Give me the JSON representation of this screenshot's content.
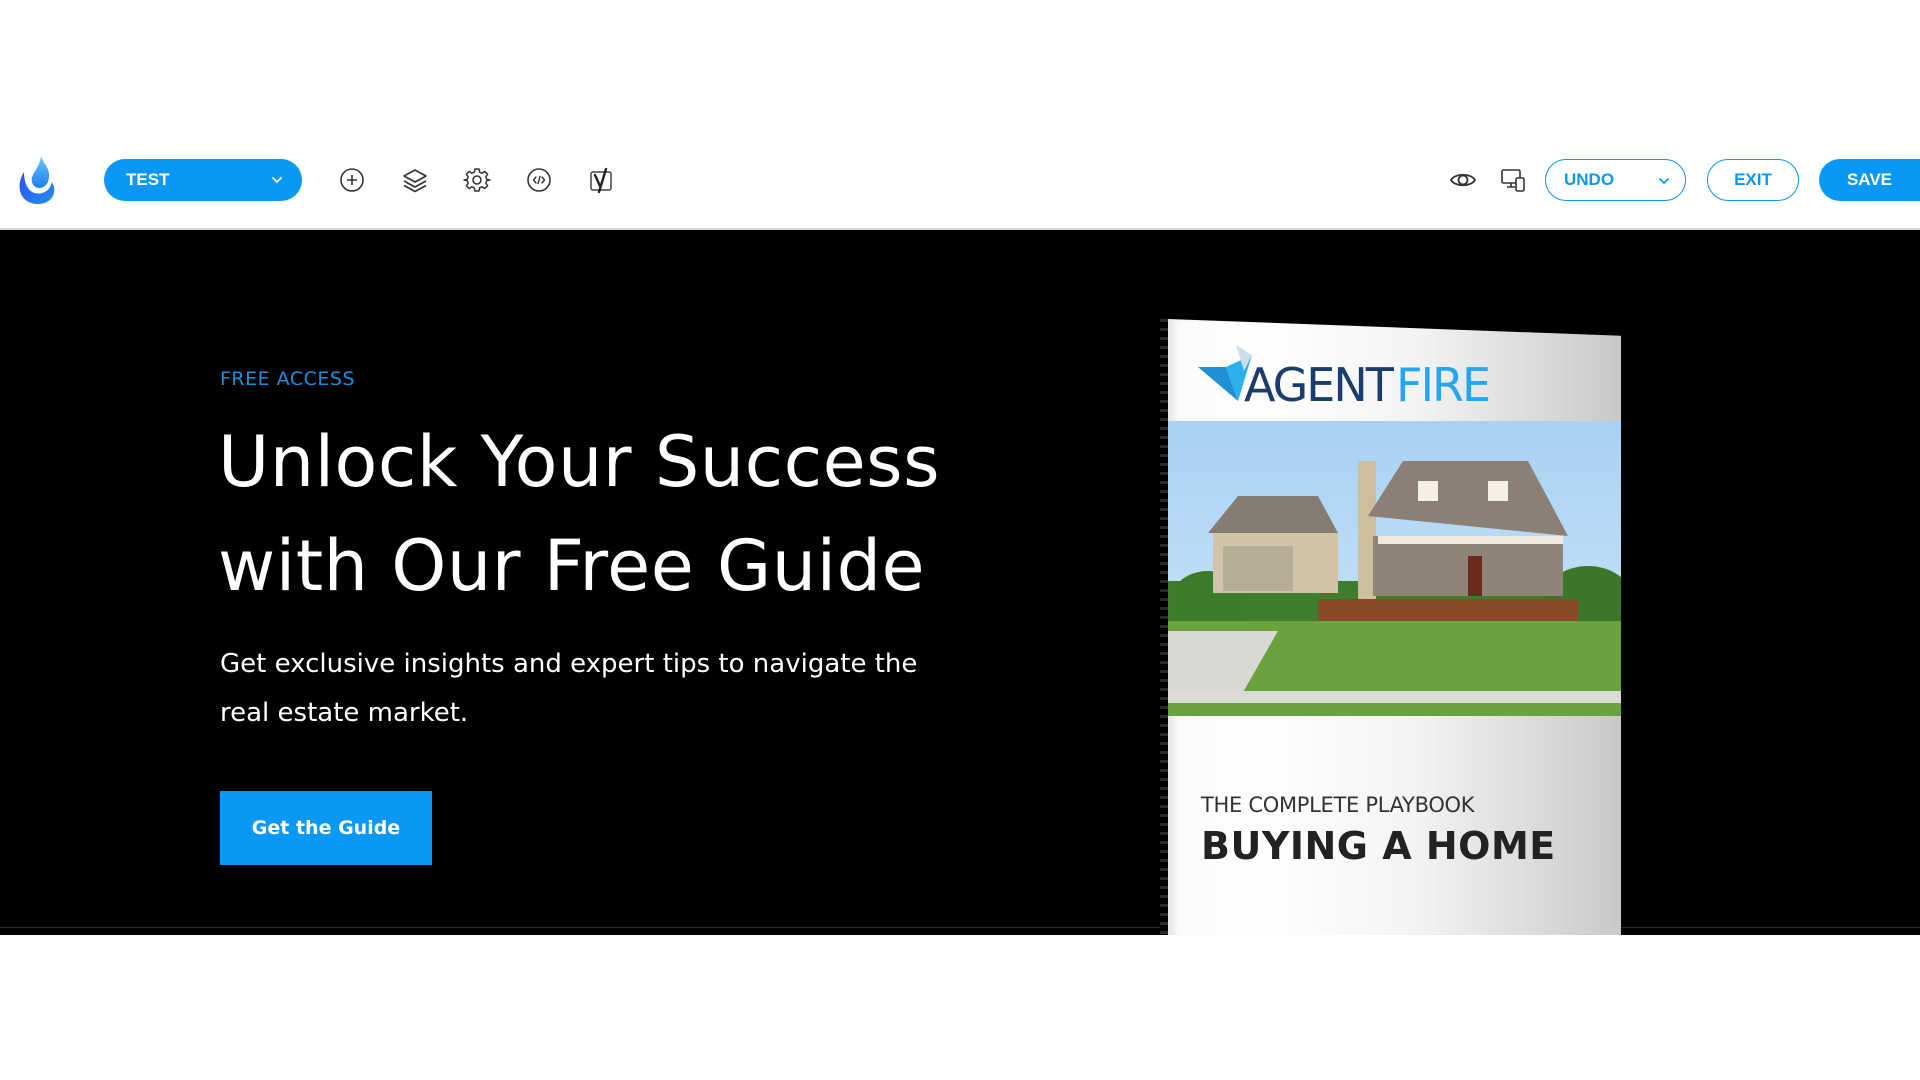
{
  "toolbar": {
    "logo": "flame-logo",
    "site_select": {
      "value": "TEST"
    },
    "left_icons": [
      "add-circle-icon",
      "layers-icon",
      "gear-icon",
      "code-icon",
      "yoast-seo-icon"
    ],
    "right_icons": [
      "eye-preview-icon",
      "responsive-devices-icon"
    ],
    "undo_label": "UNDO",
    "exit_label": "EXIT",
    "save_label": "SAVE",
    "accent_color": "#0a97f5"
  },
  "hero": {
    "eyebrow": "FREE ACCESS",
    "headline_line1": "Unlock Your Success",
    "headline_line2": "with Our Free Guide",
    "subtext_line1": "Get exclusive insights and expert tips to navigate the",
    "subtext_line2": "real estate market.",
    "cta_label": "Get the Guide",
    "background_color": "#000000"
  },
  "book": {
    "brand_left": "AGENT",
    "brand_right": "FIRE",
    "kicker": "THE COMPLETE PLAYBOOK",
    "title": "BUYING A HOME",
    "photo": "suburban house with front porch and lawn"
  }
}
